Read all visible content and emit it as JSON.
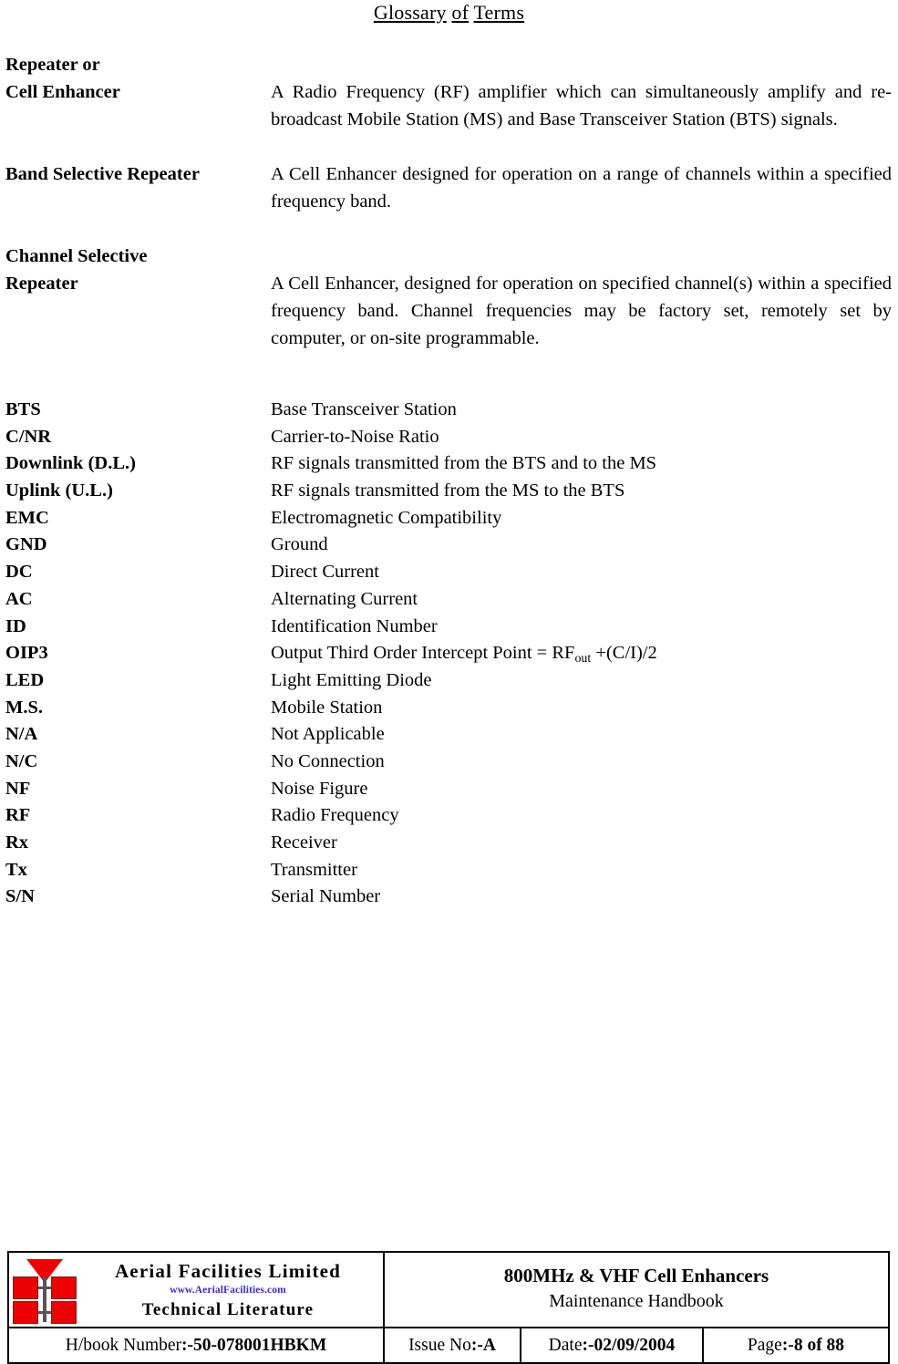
{
  "page": {
    "title_words": [
      "Glossary",
      "of",
      "Terms"
    ]
  },
  "entries": [
    {
      "term": "Repeater or\nCell Enhancer",
      "definition": "A Radio Frequency (RF) amplifier which can simultaneously amplify and re-broadcast Mobile Station (MS) and Base Transceiver Station (BTS) signals."
    },
    {
      "term": "Band Selective Repeater",
      "definition": "A Cell Enhancer designed for operation on a range of channels within a specified frequency band."
    },
    {
      "term": "Channel Selective\nRepeater",
      "definition": "A Cell Enhancer, designed for operation on specified channel(s) within a specified frequency band. Channel frequencies may be factory set, remotely set by computer, or on-site programmable."
    }
  ],
  "abbreviations": [
    {
      "key": "BTS",
      "value": "Base Transceiver Station"
    },
    {
      "key": "C/NR",
      "value": "Carrier-to-Noise Ratio"
    },
    {
      "key": "Downlink (D.L.)",
      "value": "RF signals transmitted from the BTS and to the MS"
    },
    {
      "key": "Uplink (U.L.)",
      "value": "RF signals transmitted from the MS to the BTS"
    },
    {
      "key": "EMC",
      "value": "Electromagnetic Compatibility"
    },
    {
      "key": "GND",
      "value": "Ground"
    },
    {
      "key": "DC",
      "value": "Direct Current"
    },
    {
      "key": "AC",
      "value": "Alternating Current"
    },
    {
      "key": "ID",
      "value": "Identification Number"
    },
    {
      "key": "OIP3",
      "value": "Output Third Order Intercept Point = RFout +(C/I)/2",
      "value_prefix": "Output Third Order Intercept Point = RF",
      "value_sub": "out",
      "value_suffix": " +(C/I)/2"
    },
    {
      "key": "LED",
      "value": "Light Emitting Diode"
    },
    {
      "key": "M.S.",
      "value": "Mobile Station"
    },
    {
      "key": "N/A",
      "value": "Not Applicable"
    },
    {
      "key": "N/C",
      "value": "No Connection"
    },
    {
      "key": "NF",
      "value": "Noise Figure"
    },
    {
      "key": "RF",
      "value": "Radio Frequency"
    },
    {
      "key": "Rx",
      "value": "Receiver"
    },
    {
      "key": "Tx",
      "value": "Transmitter"
    },
    {
      "key": "S/N",
      "value": "Serial Number"
    }
  ],
  "footer": {
    "company_name": "Aerial  Facilities  Limited",
    "company_url": "www.AerialFacilities.com",
    "company_tagline": "Technical Literature",
    "url_color": "#3b2fd0",
    "logo_color": "#ee0000",
    "doc_title": "800MHz & VHF Cell Enhancers",
    "doc_subtitle": "Maintenance Handbook",
    "hbook_label": "H/book Number",
    "hbook_value": ":-50-078001HBKM",
    "issue_label": "Issue No",
    "issue_value": ":-A",
    "date_label": "Date",
    "date_value": ":-02/09/2004",
    "page_label": "Page",
    "page_value": ":-8 of 88"
  }
}
